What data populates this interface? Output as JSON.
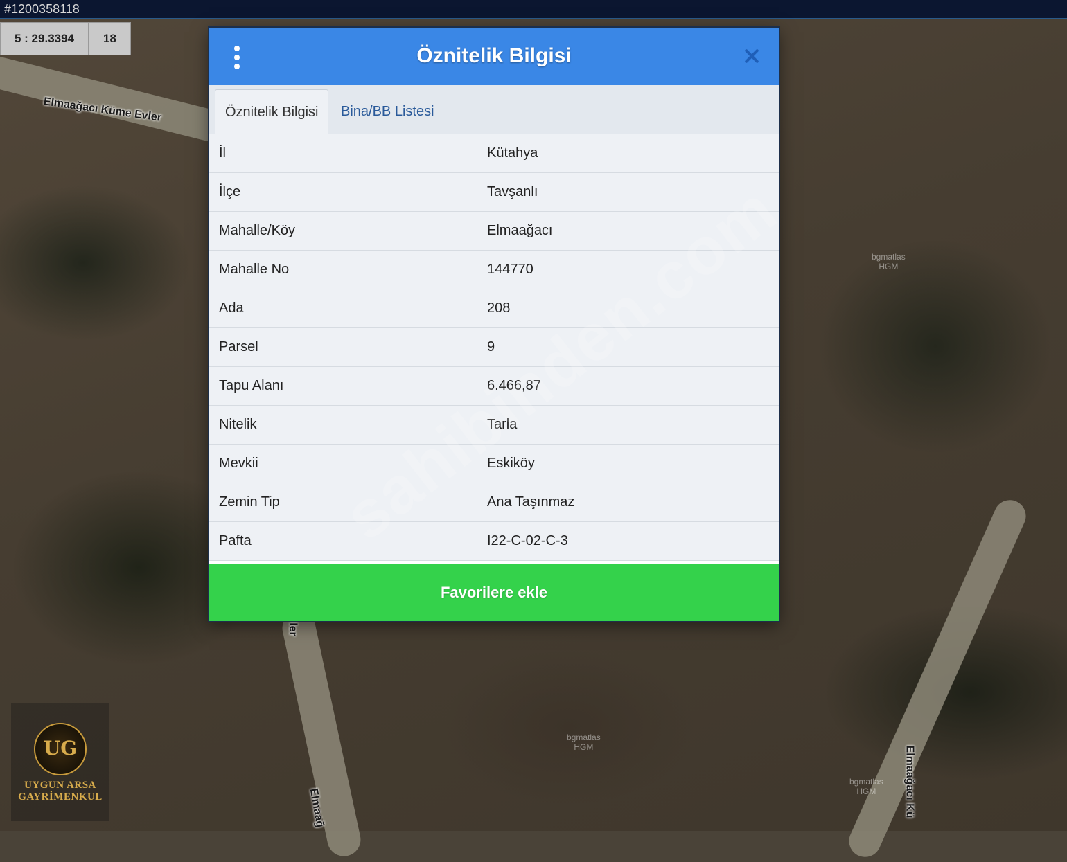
{
  "top_bar": {
    "listing_id": "#1200358118"
  },
  "scale_box": {
    "scale": "5 : 29.3394",
    "zoom": "18"
  },
  "map": {
    "road_labels": [
      "Elmaağacı Küme Evler",
      "ler",
      "Elmaağacı Kü",
      "Elmaağ"
    ],
    "hgm_label": "bgmatlas\nHGM",
    "watermark": "sahibinden.com"
  },
  "logo": {
    "line1": "UYGUN ARSA",
    "line2": "GAYRİMENKUL",
    "emblem": "UG"
  },
  "dialog": {
    "title": "Öznitelik Bilgisi",
    "tabs": [
      {
        "label": "Öznitelik Bilgisi",
        "active": true
      },
      {
        "label": "Bina/BB Listesi",
        "active": false
      }
    ],
    "rows": [
      {
        "key": "İl",
        "value": "Kütahya"
      },
      {
        "key": "İlçe",
        "value": "Tavşanlı"
      },
      {
        "key": "Mahalle/Köy",
        "value": "Elmaağacı"
      },
      {
        "key": "Mahalle No",
        "value": "144770"
      },
      {
        "key": "Ada",
        "value": "208"
      },
      {
        "key": "Parsel",
        "value": "9"
      },
      {
        "key": "Tapu Alanı",
        "value": "6.466,87"
      },
      {
        "key": "Nitelik",
        "value": "Tarla"
      },
      {
        "key": "Mevkii",
        "value": "Eskiköy"
      },
      {
        "key": "Zemin Tip",
        "value": "Ana Taşınmaz"
      },
      {
        "key": "Pafta",
        "value": "I22-C-02-C-3"
      }
    ],
    "favorite_button": "Favorilere ekle"
  },
  "colors": {
    "header": "#3a87e6",
    "button": "#34d24b"
  }
}
